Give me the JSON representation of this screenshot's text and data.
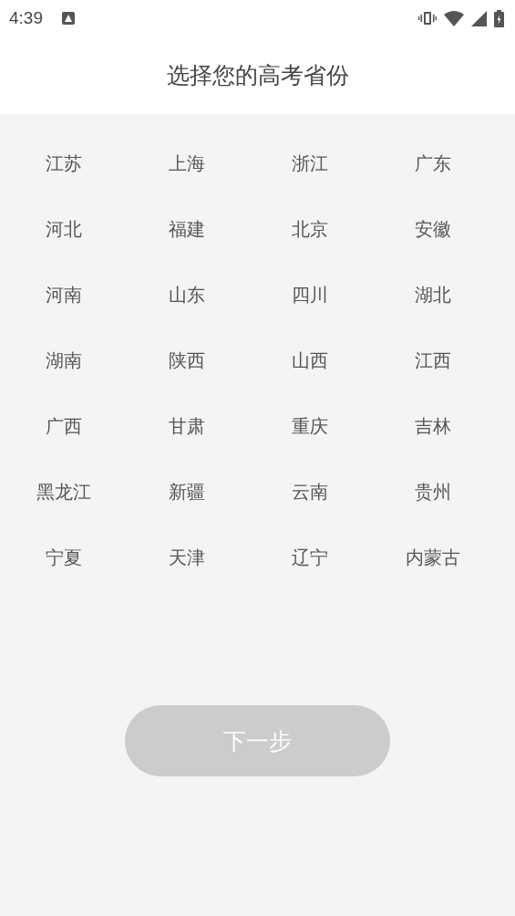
{
  "status_bar": {
    "time": "4:39"
  },
  "header": {
    "title": "选择您的高考省份"
  },
  "provinces": [
    {
      "label": "江苏",
      "selected": false
    },
    {
      "label": "上海",
      "selected": false
    },
    {
      "label": "浙江",
      "selected": false
    },
    {
      "label": "广东",
      "selected": false
    },
    {
      "label": "河北",
      "selected": false
    },
    {
      "label": "福建",
      "selected": false
    },
    {
      "label": "北京",
      "selected": false
    },
    {
      "label": "安徽",
      "selected": false
    },
    {
      "label": "河南",
      "selected": false
    },
    {
      "label": "山东",
      "selected": false
    },
    {
      "label": "四川",
      "selected": false
    },
    {
      "label": "湖北",
      "selected": false
    },
    {
      "label": "湖南",
      "selected": false
    },
    {
      "label": "陕西",
      "selected": false
    },
    {
      "label": "山西",
      "selected": false
    },
    {
      "label": "江西",
      "selected": false
    },
    {
      "label": "广西",
      "selected": false
    },
    {
      "label": "甘肃",
      "selected": false
    },
    {
      "label": "重庆",
      "selected": false
    },
    {
      "label": "吉林",
      "selected": false
    },
    {
      "label": "黑龙江",
      "selected": false
    },
    {
      "label": "新疆",
      "selected": false
    },
    {
      "label": "云南",
      "selected": false
    },
    {
      "label": "贵州",
      "selected": false
    },
    {
      "label": "宁夏",
      "selected": false
    },
    {
      "label": "天津",
      "selected": false
    },
    {
      "label": "辽宁",
      "selected": false
    },
    {
      "label": "内蒙古",
      "selected": false
    }
  ],
  "next_button": {
    "label": "下一步",
    "disabled": true
  }
}
